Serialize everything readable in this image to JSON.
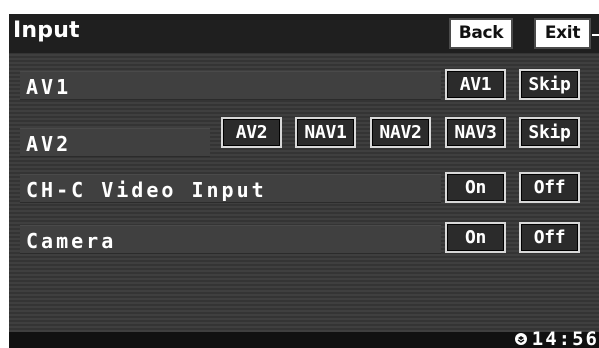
{
  "title": "Input",
  "header": {
    "back_label": "Back",
    "exit_label": "Exit"
  },
  "rows": [
    {
      "label": "AV1",
      "buttons": [
        "AV1",
        "Skip"
      ]
    },
    {
      "label": "AV2",
      "buttons": [
        "AV2",
        "NAV1",
        "NAV2",
        "NAV3",
        "Skip"
      ]
    },
    {
      "label": "CH-C Video Input",
      "buttons": [
        "On",
        "Off"
      ]
    },
    {
      "label": "Camera",
      "buttons": [
        "On",
        "Off"
      ]
    }
  ],
  "status": {
    "clock": "14:56",
    "clock_icon": "globe-clock-icon"
  },
  "colors": {
    "screen_background": "#383838",
    "title_bar": "#1f1f1f",
    "button_border": "#d8d8d8",
    "header_button_background": "#ffffff"
  }
}
